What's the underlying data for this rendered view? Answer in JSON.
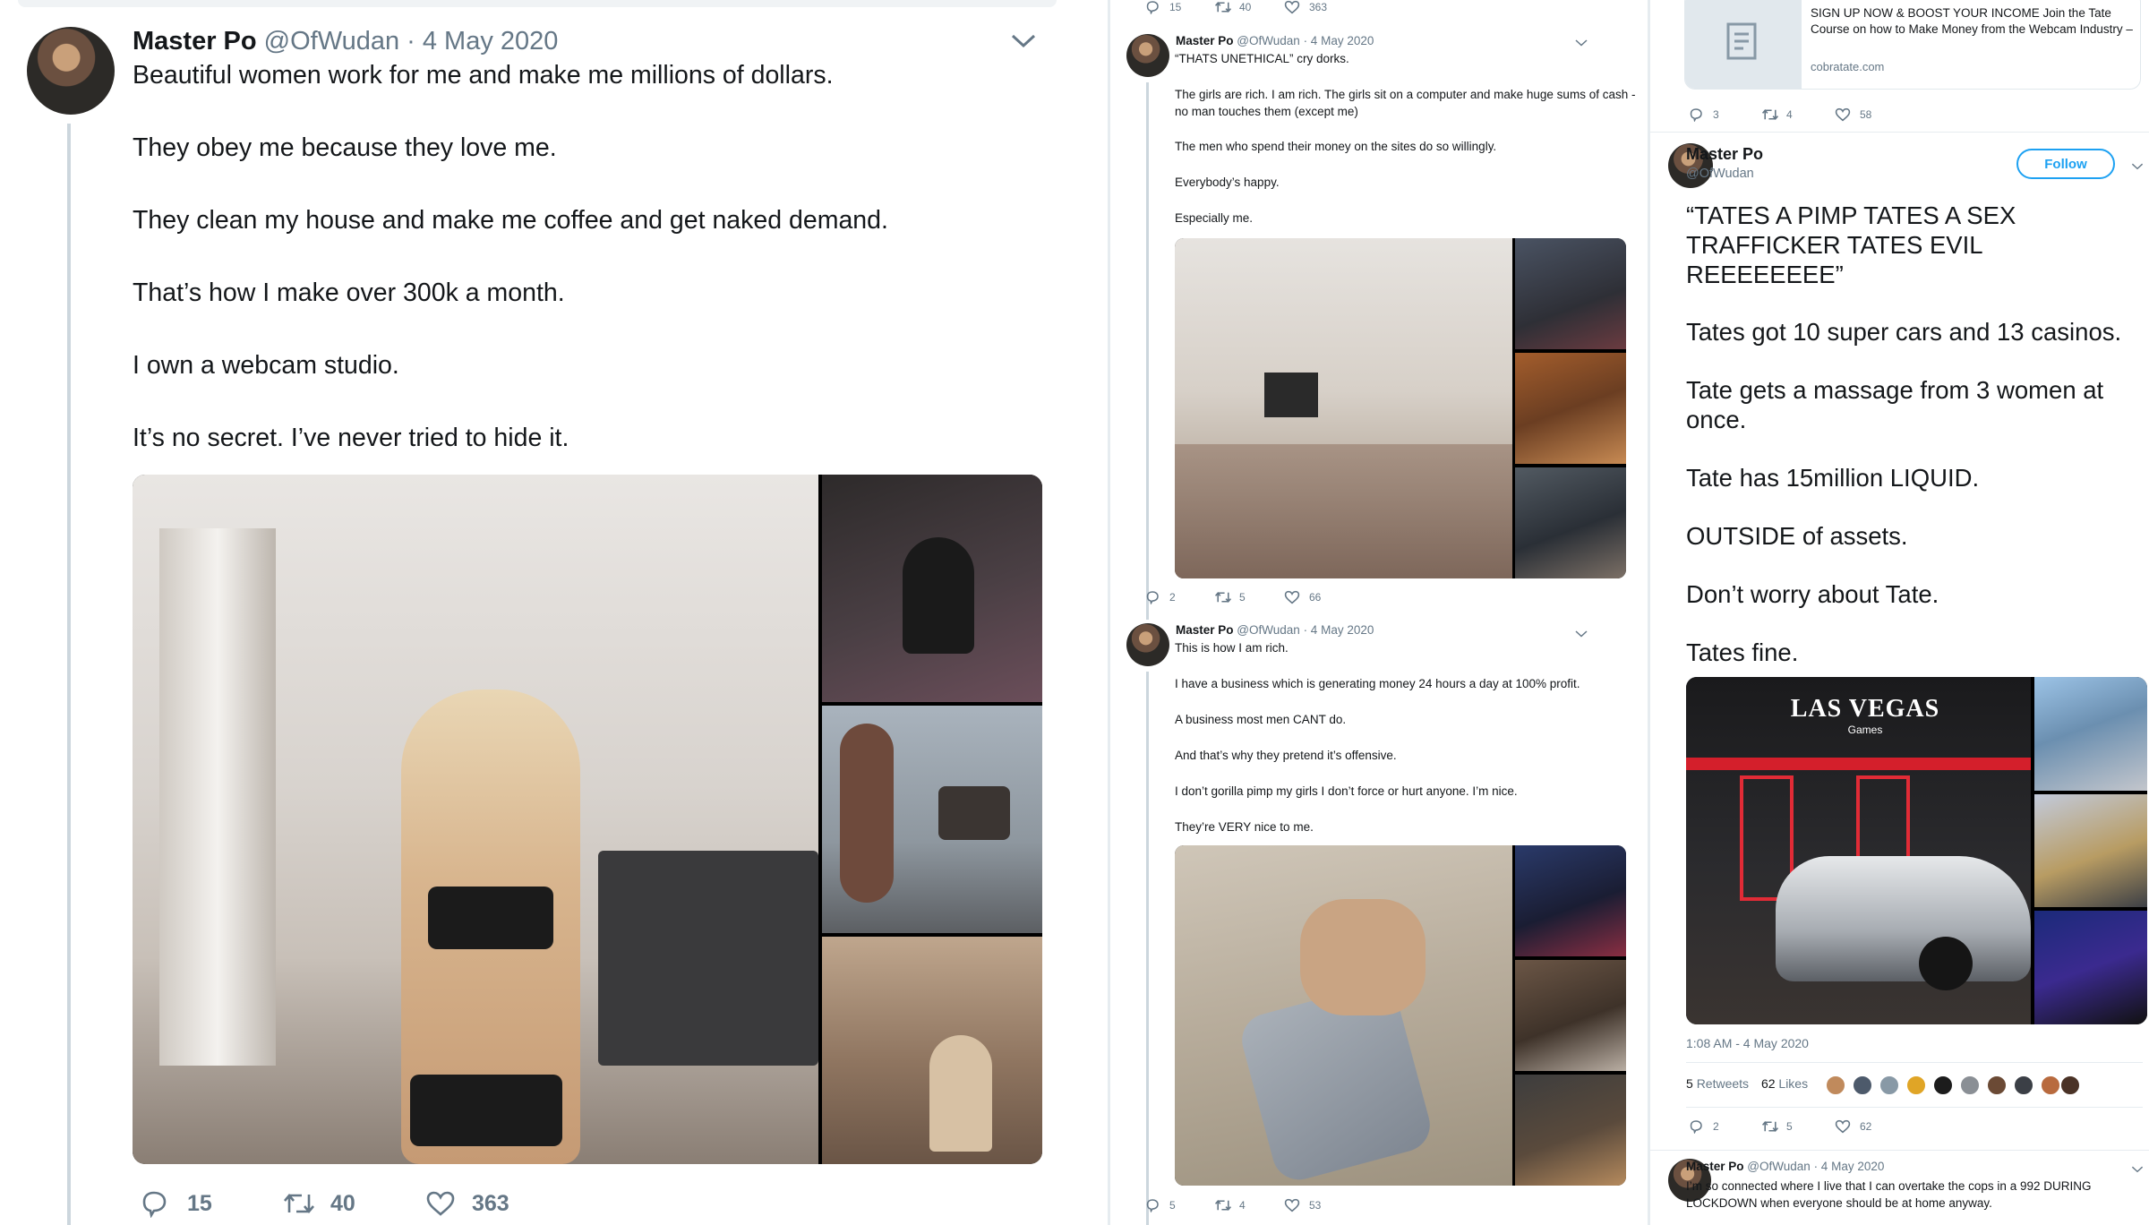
{
  "colors": {
    "accent": "#1da1f2",
    "text": "#14171a",
    "secondary": "#657786",
    "divider": "#e6ecf0"
  },
  "left_tweet": {
    "name": "Master Po",
    "handle": "@OfWudan",
    "date": "· 4 May 2020",
    "lines": [
      "Beautiful women work for me and make me millions of dollars.",
      "They obey me because they love me.",
      "They clean my house and make me coffee and get naked demand.",
      "That’s how I make over 300k a month.",
      "I own a webcam studio.",
      "It’s no secret. I’ve never tried to hide it."
    ],
    "replies": "15",
    "retweets": "40",
    "likes": "363"
  },
  "middle": {
    "top_counts": {
      "replies": "15",
      "retweets": "40",
      "likes": "363"
    },
    "tweet1": {
      "name": "Master Po",
      "handle": "@OfWudan",
      "date": "· 4 May 2020",
      "lines": [
        "“THATS UNETHICAL” cry dorks.",
        "The girls are rich. I am rich. The girls sit on a computer and make huge sums of cash - no man touches them (except me)",
        "The men who spend their money on the sites do so willingly.",
        "Everybody’s happy.",
        "Especially me."
      ],
      "replies": "2",
      "retweets": "5",
      "likes": "66"
    },
    "tweet2": {
      "name": "Master Po",
      "handle": "@OfWudan",
      "date": "· 4 May 2020",
      "lines": [
        "This is how I am rich.",
        "I have a business which is generating money 24 hours a day at 100% profit.",
        "A business most men CANT do.",
        "And that’s why they pretend it’s offensive.",
        "I don’t gorilla pimp my girls I don’t force or hurt anyone. I’m nice.",
        "They’re VERY nice to me."
      ],
      "replies": "5",
      "retweets": "4",
      "likes": "53"
    }
  },
  "right": {
    "link_card": {
      "title": "SIGN UP NOW & BOOST YOUR INCOME Join the Tate Course on how to Make Money from the Webcam Industry –",
      "domain": "cobratate.com"
    },
    "top_counts": {
      "replies": "3",
      "retweets": "4",
      "likes": "58"
    },
    "main_tweet": {
      "name": "Master Po",
      "handle": "@OfWudan",
      "follow_label": "Follow",
      "lines": [
        "“TATES A PIMP TATES A SEX TRAFFICKER TATES EVIL REEEEEEEE”",
        "Tates got 10 super cars and 13 casinos.",
        "Tate gets a massage from 3 women at once.",
        "Tate has 15million LIQUID.",
        "OUTSIDE of assets.",
        "Don’t worry about Tate.",
        "Tates fine."
      ],
      "sign_text": "LAS VEGAS",
      "sign_sub": "Games",
      "timestamp": "1:08 AM - 4 May 2020",
      "retweets_count": "5",
      "retweets_label": "Retweets",
      "likes_count": "62",
      "likes_label": "Likes",
      "replies": "2",
      "retweets": "5",
      "likes": "62"
    },
    "reply_tweet": {
      "name": "Master Po",
      "handle": "@OfWudan",
      "date": "· 4 May 2020",
      "text": "I’m so connected where I live that I can overtake the cops in a 992 DURING LOCKDOWN when everyone should be at home anyway."
    }
  }
}
